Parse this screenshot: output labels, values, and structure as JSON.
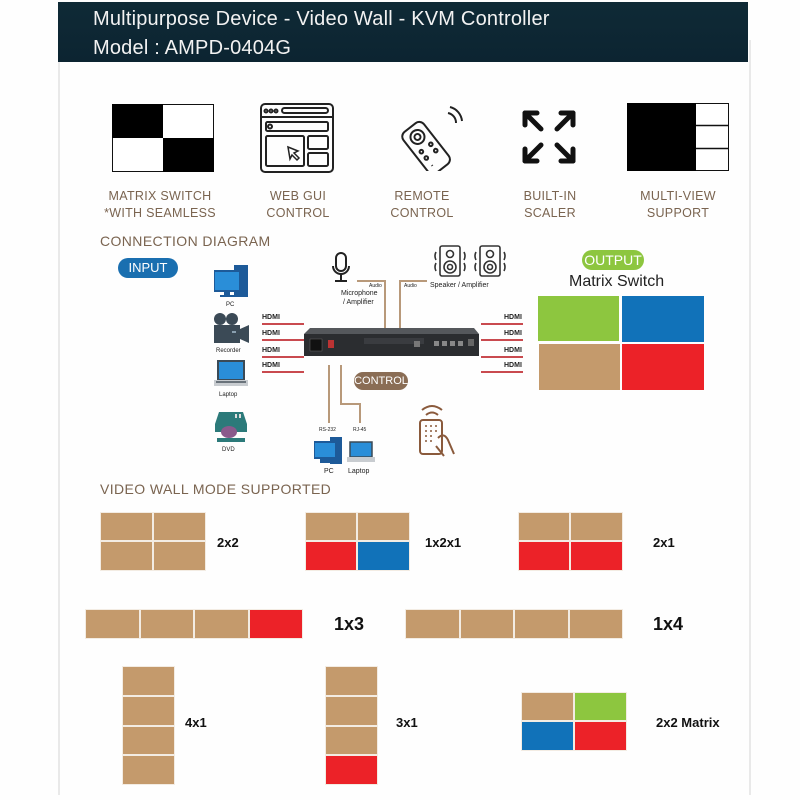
{
  "header": {
    "title": "Multipurpose Device - Video Wall - KVM Controller",
    "model": "Model : AMPD-0404G"
  },
  "features": [
    {
      "icon": "matrix-switch-icon",
      "line1": "MATRIX SWITCH",
      "line2": "*WITH SEAMLESS"
    },
    {
      "icon": "web-gui-icon",
      "line1": "WEB GUI",
      "line2": "CONTROL"
    },
    {
      "icon": "remote-control-icon",
      "line1": "REMOTE",
      "line2": "CONTROL"
    },
    {
      "icon": "scaler-arrows-icon",
      "line1": "BUILT-IN",
      "line2": "SCALER"
    },
    {
      "icon": "multi-view-icon",
      "line1": "MULTI-VIEW",
      "line2": "SUPPORT"
    }
  ],
  "connection": {
    "title": "CONNECTION DIAGRAM",
    "input_label": "INPUT",
    "output_label": "OUTPUT",
    "control_label": "CONTROL",
    "matrix_title": "Matrix Switch",
    "inputs": [
      "PC",
      "Recorder",
      "Laptop",
      "DVD"
    ],
    "hdmi": [
      "HDMI",
      "HDMI",
      "HDMI",
      "HDMI"
    ],
    "audio_in": "Audio",
    "audio_out": "Audio",
    "microphone": "Microphone",
    "mic_amp": "/ Amplifier",
    "speaker": "Speaker / Amplifier",
    "rs232": "RS-232",
    "rj45": "RJ-45",
    "control_pc": "PC",
    "control_laptop": "Laptop"
  },
  "colors": {
    "tan": "#c49a6c",
    "red": "#ec2228",
    "blue": "#1172b9",
    "green": "#8dc63f",
    "header_bg": "#0c2431",
    "label_brown": "#7a6450",
    "input_pill": "#1a6fb0",
    "output_pill": "#8dc63f",
    "control_pill": "#8a6d55"
  },
  "video_wall": {
    "title": "VIDEO WALL MODE SUPPORTED",
    "modes": [
      "2x2",
      "1x2x1",
      "2x1",
      "1x3",
      "1x4",
      "4x1",
      "3x1",
      "2x2 Matrix"
    ]
  }
}
